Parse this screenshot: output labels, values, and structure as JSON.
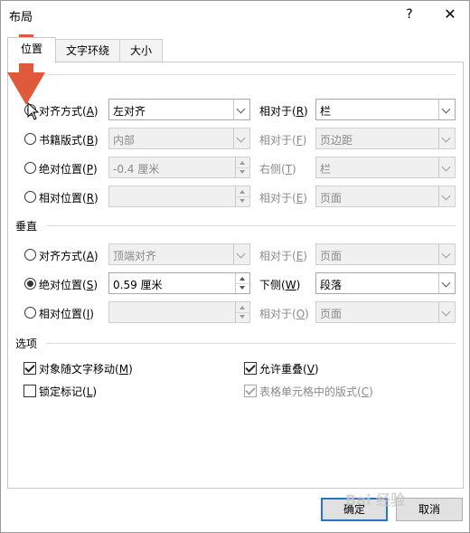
{
  "window": {
    "title": "布局",
    "help_label": "?",
    "close_label": "✕"
  },
  "tabs": [
    {
      "label": "位置",
      "active": true
    },
    {
      "label": "文字环绕",
      "active": false
    },
    {
      "label": "大小",
      "active": false
    }
  ],
  "horizontal": {
    "section_label": "",
    "rows": [
      {
        "option": "对齐方式",
        "key": "A",
        "selected": true,
        "value": "左对齐",
        "rel_label": "相对于",
        "rel_key": "R",
        "rel_value": "栏",
        "enabled": true
      },
      {
        "option": "书籍版式",
        "key": "B",
        "selected": false,
        "value": "内部",
        "rel_label": "相对于",
        "rel_key": "F",
        "rel_value": "页边距",
        "enabled": false
      },
      {
        "option": "绝对位置",
        "key": "P",
        "selected": false,
        "value": "-0.4 厘米",
        "rel_label": "右侧",
        "rel_key": "T",
        "rel_value": "栏",
        "enabled": false
      },
      {
        "option": "相对位置",
        "key": "R",
        "selected": false,
        "value": "",
        "rel_label": "相对于",
        "rel_key": "E",
        "rel_value": "页面",
        "enabled": false
      }
    ]
  },
  "vertical": {
    "section_label": "垂直",
    "rows": [
      {
        "option": "对齐方式",
        "key": "A",
        "selected": false,
        "value": "顶端对齐",
        "rel_label": "相对于",
        "rel_key": "E",
        "rel_value": "页面",
        "enabled": false
      },
      {
        "option": "绝对位置",
        "key": "S",
        "selected": true,
        "value": "0.59 厘米",
        "rel_label": "下侧",
        "rel_key": "W",
        "rel_value": "段落",
        "enabled": true
      },
      {
        "option": "相对位置",
        "key": "I",
        "selected": false,
        "value": "",
        "rel_label": "相对于",
        "rel_key": "O",
        "rel_value": "页面",
        "enabled": false
      }
    ]
  },
  "options": {
    "section_label": "选项",
    "items": [
      {
        "label": "对象随文字移动",
        "key": "M",
        "checked": true,
        "enabled": true
      },
      {
        "label": "锁定标记",
        "key": "L",
        "checked": false,
        "enabled": true
      },
      {
        "label": "允许重叠",
        "key": "V",
        "checked": true,
        "enabled": true
      },
      {
        "label": "表格单元格中的版式",
        "key": "C",
        "checked": true,
        "enabled": false
      }
    ]
  },
  "buttons": {
    "ok": "确定",
    "cancel": "取消"
  },
  "colors": {
    "arrow": "#e0593b",
    "focus_blue": "#2a73c8"
  },
  "watermark": "Bai 经验"
}
